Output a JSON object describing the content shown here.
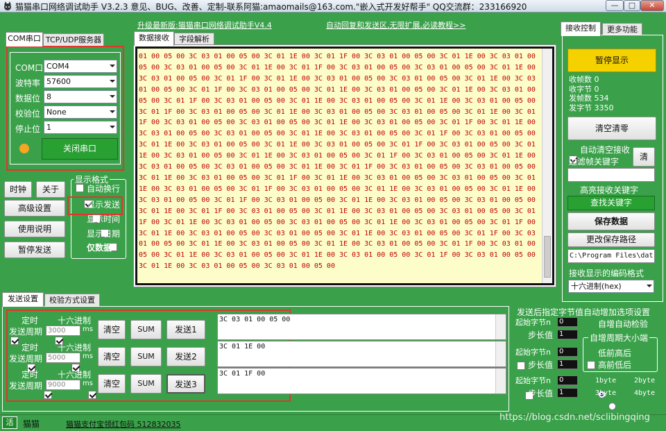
{
  "window": {
    "title": "猫猫串口网络调试助手 V3.2.3 意见、BUG、改善、定制-联系阿猫:amaomails@163.com.\"嵌入式开发好帮手\" QQ交流群：233166920",
    "btn_min": "—",
    "btn_max": "□",
    "btn_close": "✕"
  },
  "left": {
    "tabs": [
      "COM串口",
      "TCP/UDP服务器"
    ],
    "port_labels": [
      "COM口",
      "波特率",
      "数据位",
      "校验位",
      "停止位"
    ],
    "port_values": [
      "COM4",
      "57600",
      "8",
      "None",
      "1"
    ],
    "close_port": "关闭串口",
    "status_color": "#f5a623",
    "btn_clock": "时钟",
    "btn_about": "关于",
    "btn_advanced": "高级设置",
    "btn_manual": "使用说明",
    "btn_pause_send": "暂停发送",
    "display_group": "显示格式",
    "display_opts": [
      "自动换行",
      "显示发送",
      "显示时间",
      "显示日期",
      "仅数据"
    ],
    "display_checked": [
      false,
      true,
      false,
      false,
      false
    ]
  },
  "center": {
    "upgrade_link": "升级最新版:猫猫串口网络调试助手V4.4",
    "auto_reply_link": "自动回复和发送区,无限扩展,必读教程>>",
    "tabs": [
      "数据接收",
      "字段解析"
    ],
    "receive_lines": [
      "01 00 05 00 3C 03 01 00 05 00 3C 01 1E 00 3C 01 1F 00 3C 03 01 00 05 00 3C 01 1E 00 3C 03 01 00",
      "05 00 3C 03 01 00 05 00 3C 01 1E 00 3C 01 1F 00 3C 03 01 00 05 00 3C 03 01 00 05 00 3C 01 1E 00",
      "3C 03 01 00 05 00 3C 01 1F 00 3C 01 1E 00 3C 03 01 00 05 00 3C 03 01 00 05 00 3C 01 1E 00 3C 03",
      "01 00 05 00 3C 01 1F 00 3C 03 01 00 05 00 3C 01 1E 00 3C 03 01 00 05 00 3C 01 1E 00 3C 03 01 00",
      "05 00 3C 01 1F 00 3C 03 01 00 05 00 3C 01 1E 00 3C 03 01 00 05 00 3C 01 1E 00 3C 03 01 00 05 00",
      "3C 01 1F 00 3C 03 01 00 05 00 3C 01 1E 00 3C 03 01 00 05 00 3C 03 01 00 05 00 3C 01 1E 00 3C 01",
      "1F 00 3C 03 01 00 05 00 3C 03 01 00 05 00 3C 01 1E 00 3C 03 01 00 05 00 3C 01 1F 00 3C 01 1E 00",
      "3C 03 01 00 05 00 3C 03 01 00 05 00 3C 01 1E 00 3C 03 01 00 05 00 3C 01 1F 00 3C 03 01 00 05 00",
      "3C 01 1E 00 3C 03 01 00 05 00 3C 01 1E 00 3C 03 01 00 05 00 3C 01 1F 00 3C 03 01 00 05 00 3C 01",
      "1E 00 3C 03 01 00 05 00 3C 01 1E 00 3C 03 01 00 05 00 3C 01 1F 00 3C 03 01 00 05 00 3C 01 1E 00",
      "3C 03 01 00 05 00 3C 03 01 00 05 00 3C 01 1E 00 3C 01 1F 00 3C 03 01 00 05 00 3C 03 01 00 05 00",
      "3C 01 1E 00 3C 03 01 00 05 00 3C 01 1F 00 3C 01 1E 00 3C 03 01 00 05 00 3C 03 01 00 05 00 3C 01",
      "1E 00 3C 03 01 00 05 00 3C 01 1F 00 3C 03 01 00 05 00 3C 01 1E 00 3C 03 01 00 05 00 3C 01 1E 00",
      "3C 03 01 00 05 00 3C 01 1F 00 3C 03 01 00 05 00 3C 01 1E 00 3C 03 01 00 05 00 3C 03 01 00 05 00",
      "3C 01 1E 00 3C 01 1F 00 3C 03 01 00 05 00 3C 01 1E 00 3C 03 01 00 05 00 3C 03 01 00 05 00 3C 01",
      "1F 00 3C 01 1E 00 3C 03 01 00 05 00 3C 03 01 00 05 00 3C 01 1E 00 3C 03 01 00 05 00 3C 01 1F 00",
      "3C 01 1E 00 3C 03 01 00 05 00 3C 03 01 00 05 00 3C 01 1E 00 3C 03 01 00 05 00 3C 01 1F 00 3C 03",
      "01 00 05 00 3C 01 1E 00 3C 03 01 00 05 00 3C 01 1E 00 3C 03 01 00 05 00 3C 01 1F 00 3C 03 01 00",
      "05 00 3C 01 1E 00 3C 03 01 00 05 00 3C 01 1E 00 3C 03 01 00 05 00 3C 01 1F 00 3C 03 01 00 05 00",
      "3C 01 1E 00 3C 03 01 00 05 00 3C 03 01 00 05 00"
    ]
  },
  "right": {
    "tabs": [
      "接收控制",
      "更多功能"
    ],
    "pause_display": "暂停显示",
    "stats": [
      "收帧数 0",
      "收字节 0",
      "发帧数 534",
      "发字节 3350"
    ],
    "clear_counts": "清空清零",
    "auto_clear": "自动清空接收",
    "filter_keyword": "过滤帧关键字",
    "clear_small": "清",
    "highlight_kw": "高亮接收关键字",
    "find_kw": "查找关键字",
    "save_data": "保存数据",
    "change_path": "更改保存路径",
    "path": "C:\\Program Files\\dat",
    "encoding_label": "接收显示的编码格式",
    "encoding_value": "十六进制(hex)",
    "pause_color": "#f5d100"
  },
  "bottom": {
    "tabs": [
      "发送设置",
      "校验方式设置"
    ],
    "rows": [
      {
        "timer": "定时",
        "hex": "十六进制",
        "period_label": "发送周期",
        "period": "3000",
        "unit": "ms",
        "clear": "清空",
        "sum": "SUM",
        "send": "发送1",
        "content": "3C 03 01 00 05 00"
      },
      {
        "timer": "定时",
        "hex": "十六进制",
        "period_label": "发送周期",
        "period": "5000",
        "unit": "ms",
        "clear": "清空",
        "sum": "SUM",
        "send": "发送2",
        "content": "3C 01 1E 00"
      },
      {
        "timer": "定时",
        "hex": "十六进制",
        "period_label": "发送周期",
        "period": "9000",
        "unit": "ms",
        "clear": "清空",
        "sum": "SUM",
        "send": "发送3",
        "content": "3C 01 1F 00"
      }
    ],
    "auto_inc_title": "发送后指定字节值自动增加选项设置",
    "start_byte": "起始字节n",
    "step": "步长值",
    "start_values": [
      "0",
      "0",
      "0"
    ],
    "step_values": [
      "1",
      "1",
      "1"
    ],
    "auto_checksum": "自增自动检验",
    "endian_group": "自增周期大小端",
    "endian_opts": [
      "低前高后",
      "高前低后"
    ],
    "byte_opts": [
      "1byte",
      "2byte",
      "3byte",
      "4byte"
    ]
  },
  "status": {
    "indicator": "活",
    "name": "猫猫",
    "pay_link": "猫猫支付宝领红包码 512832035",
    "watermark": "https://blog.csdn.net/sclibingqing"
  }
}
